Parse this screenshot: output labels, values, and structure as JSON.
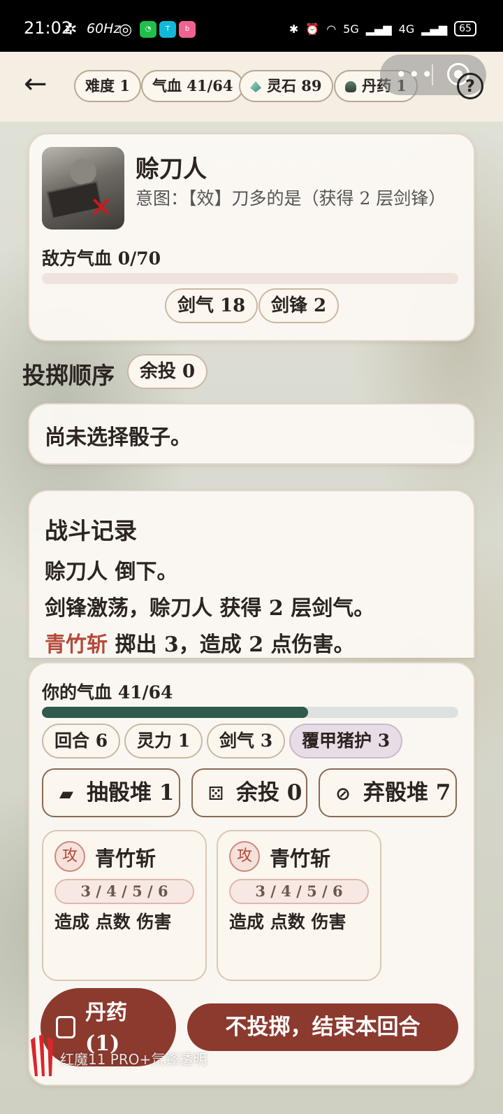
{
  "status_bar": {
    "time": "21:02",
    "refresh": "60Hz",
    "battery": "65",
    "net1": "5G",
    "net2": "4G"
  },
  "top_bar": {
    "difficulty": "难度 1",
    "hp": "气血 41/64",
    "spirit_stones": "灵石 89",
    "pills": "丹药 1"
  },
  "enemy": {
    "name": "赊刀人",
    "intent": "意图：【效】刀多的是（获得 2 层剑锋）",
    "hp_label": "敌方气血 0/70",
    "hp_fraction": 0,
    "buffs": [
      "剑气 18",
      "剑锋 2"
    ]
  },
  "throw_order": {
    "title": "投掷顺序",
    "remaining": "余投 0",
    "empty_message": "尚未选择骰子。"
  },
  "battle_log": {
    "title": "战斗记录",
    "lines": [
      {
        "text": "赊刀人 倒下。"
      },
      {
        "text": "剑锋激荡，赊刀人 获得 2 层剑气。"
      },
      {
        "skill": "青竹斩",
        "text": " 掷出 3，造成 2 点伤害。"
      }
    ]
  },
  "player": {
    "hp_label": "你的气血 41/64",
    "hp_fraction": 0.64,
    "stats": [
      "回合 6",
      "灵力 1",
      "剑气 3",
      "覆甲猪护 3"
    ],
    "piles": {
      "draw": "抽骰堆 1",
      "remaining": "余投 0",
      "discard": "弃骰堆 7"
    },
    "dice": [
      {
        "tag": "攻",
        "name": "青竹斩",
        "faces": "3 / 4 / 5 / 6",
        "desc": "造成 点数 伤害"
      },
      {
        "tag": "攻",
        "name": "青竹斩",
        "faces": "3 / 4 / 5 / 6",
        "desc": "造成 点数 伤害"
      }
    ],
    "potion_line1": "丹药",
    "potion_line2": "(1)",
    "end_turn": "不投掷，结束本回合"
  },
  "watermark": "红魔11 PRO+氘锋透明",
  "colors": {
    "accent": "#8c3a2e",
    "hp_fill": "#2f5a4c",
    "skill_text": "#b44a3a"
  }
}
